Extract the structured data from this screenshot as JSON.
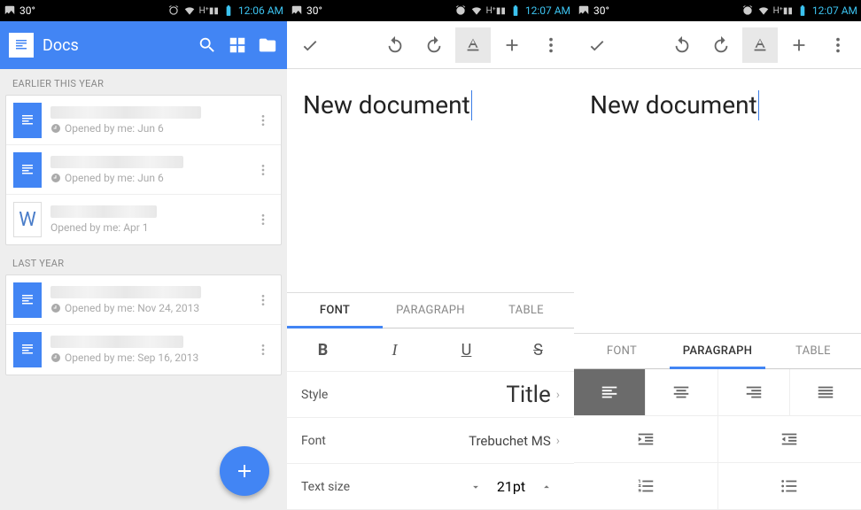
{
  "status": {
    "temp": "30°",
    "time1": "12:06 AM",
    "time2": "12:07 AM",
    "time3": "12:07 AM"
  },
  "p1": {
    "title": "Docs",
    "sections": [
      {
        "header": "EARLIER THIS YEAR",
        "items": [
          {
            "meta": "Opened by me: Jun 6",
            "type": "d"
          },
          {
            "meta": "Opened by me: Jun 6",
            "type": "d"
          },
          {
            "meta": "Opened by me: Apr 1",
            "type": "w"
          }
        ]
      },
      {
        "header": "LAST YEAR",
        "items": [
          {
            "meta": "Opened by me: Nov 24, 2013",
            "type": "d"
          },
          {
            "meta": "Opened by me: Sep 16, 2013",
            "type": "d"
          }
        ]
      }
    ]
  },
  "editor": {
    "doctext": "New document",
    "tabs": {
      "font": "FONT",
      "paragraph": "PARAGRAPH",
      "table": "TABLE"
    },
    "style_label": "Style",
    "style_value": "Title",
    "font_label": "Font",
    "font_value": "Trebuchet MS",
    "size_label": "Text size",
    "size_value": "21pt"
  }
}
